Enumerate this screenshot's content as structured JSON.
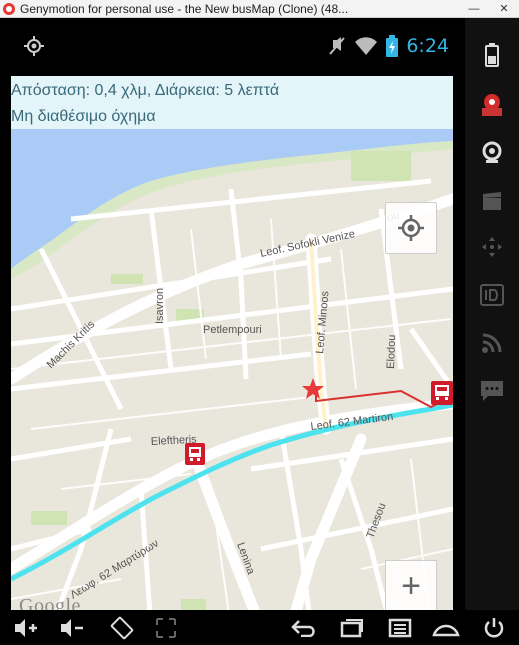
{
  "window": {
    "title": "Genymotion for personal use -  the New busMap (Clone) (48..."
  },
  "statusbar": {
    "time": "6:24"
  },
  "info": {
    "distance_text": "Απόσταση: 0,4 χλμ, Διάρκεια: 5 λεπτά",
    "vehicle_text": "Μη διαθέσιμο όχημα"
  },
  "map": {
    "labels": {
      "sofokli": "Leof. Sofokli Venize",
      "ou": "ou",
      "machis": "Machis Kritis",
      "isavron": "Isavron",
      "petlempouri": "Petlempouri",
      "minoos": "Leof. Minoos",
      "elodou": "Elodou",
      "eleftherias": "Eleftheris",
      "martiron": "Leof. 62 Martiron",
      "thesou": "Thesou",
      "lenina": "Lenina",
      "martyron_greek": "Λεωφ. 62 Μαρτύρων"
    },
    "zoom_in_label": "+",
    "zoom_out_label": "−",
    "attribution": "Google",
    "route_color": "#4de3ee",
    "walk_color": "#d9312f"
  }
}
